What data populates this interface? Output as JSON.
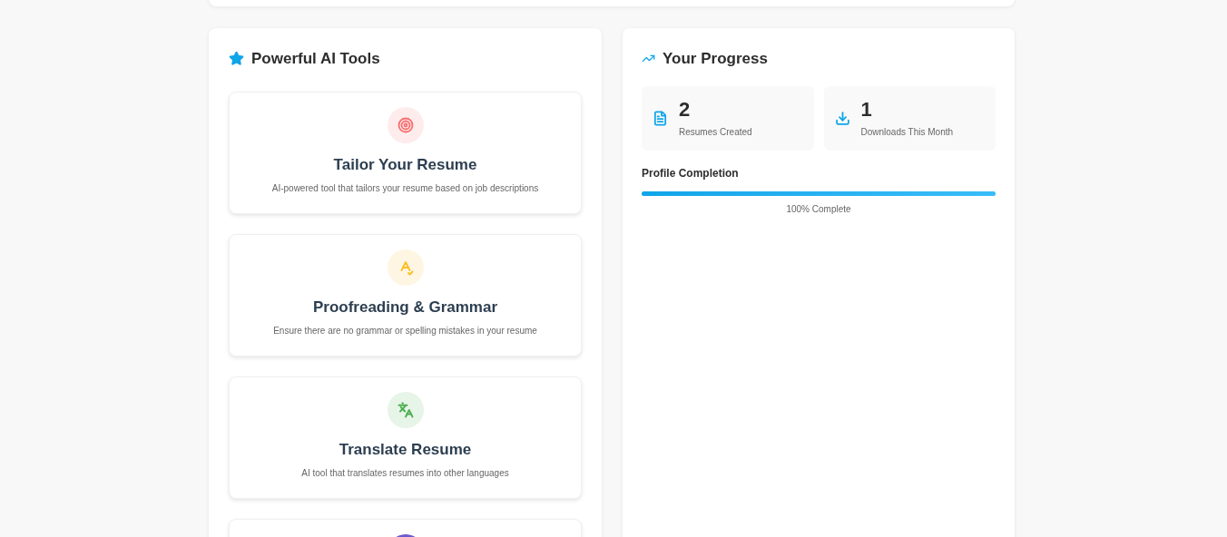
{
  "tools_panel": {
    "title": "Powerful AI Tools",
    "tools": [
      {
        "kind": "target",
        "color": "#f87171",
        "title": "Tailor Your Resume",
        "description": "AI-powered tool that tailors your resume based on job descriptions"
      },
      {
        "kind": "spellcheck",
        "color": "#fbbf24",
        "title": "Proofreading & Grammar",
        "description": "Ensure there are no grammar or spelling mistakes in your resume"
      },
      {
        "kind": "translate",
        "color": "#4caf50",
        "title": "Translate Resume",
        "description": "AI tool that translates resumes into other languages"
      },
      {
        "kind": "solid",
        "color": "#6a5acd"
      }
    ]
  },
  "progress_panel": {
    "title": "Your Progress",
    "stats": [
      {
        "kind": "document",
        "value": "2",
        "label": "Resumes Created"
      },
      {
        "kind": "download",
        "value": "1",
        "label": "Downloads This Month"
      }
    ],
    "completion": {
      "label": "Profile Completion",
      "level": 1,
      "reading": "100% Complete"
    }
  }
}
